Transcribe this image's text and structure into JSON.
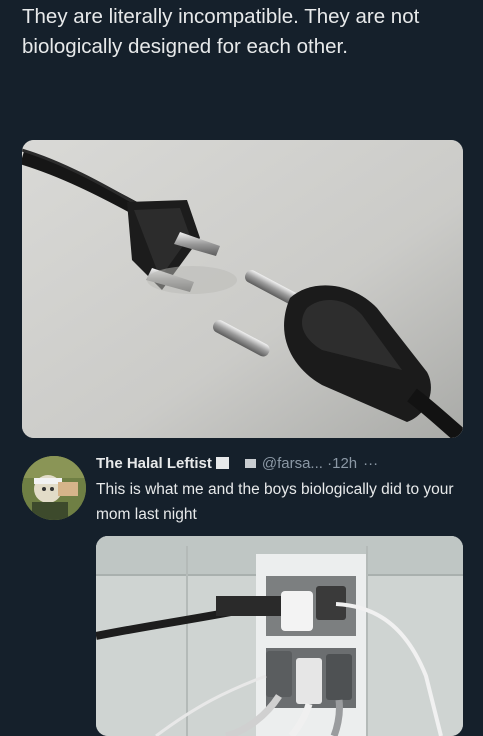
{
  "quote": {
    "text": "They are literally incompatible. They are not biologically designed for each other."
  },
  "reply": {
    "name": "The Halal Leftist",
    "handle": "@farsa...",
    "separator": "·",
    "time": "12h",
    "more": "···",
    "text": "This is what me and the boys biologically did to your mom last night"
  },
  "icons": {
    "more": "more-horizontal-icon",
    "flag": "flag-icon",
    "badge": "badge-icon"
  }
}
